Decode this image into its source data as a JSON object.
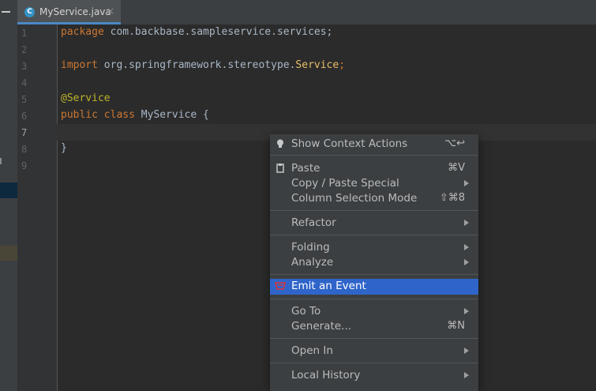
{
  "tab": {
    "icon_letter": "C",
    "filename": "MyService.java",
    "close": "×"
  },
  "gutter": {
    "lines": [
      "1",
      "2",
      "3",
      "4",
      "5",
      "6",
      "7",
      "8",
      "9"
    ]
  },
  "code": {
    "line1": {
      "kw": "package",
      "rest": " com.backbase.sampleservice.services;"
    },
    "line3": {
      "kw": "import",
      "rest": " org.springframework.stereotype.",
      "cls": "Service",
      "semi": ";"
    },
    "line5": {
      "ann": "@Service"
    },
    "line6": {
      "kw": "public class",
      "rest": " MyService {"
    },
    "line8": {
      "text": "}"
    }
  },
  "menu": {
    "show_context_actions": {
      "label": "Show Context Actions",
      "shortcut": "⌥↩",
      "icon": "lightbulb-icon"
    },
    "paste": {
      "label": "Paste",
      "shortcut": "⌘V",
      "icon": "clipboard-icon"
    },
    "copy_paste_special": {
      "label": "Copy / Paste Special"
    },
    "column_selection": {
      "label": "Column Selection Mode",
      "shortcut": "⇧⌘8"
    },
    "refactor": {
      "label": "Refactor"
    },
    "folding": {
      "label": "Folding"
    },
    "analyze": {
      "label": "Analyze"
    },
    "emit_event": {
      "label": "Emit an Event",
      "icon": "event-icon"
    },
    "go_to": {
      "label": "Go To"
    },
    "generate": {
      "label": "Generate...",
      "shortcut": "⌘N"
    },
    "open_in": {
      "label": "Open In"
    },
    "local_history": {
      "label": "Local History"
    }
  },
  "colors": {
    "accent": "#2f65ca",
    "keyword": "#cc7832",
    "annotation": "#bbb529"
  }
}
